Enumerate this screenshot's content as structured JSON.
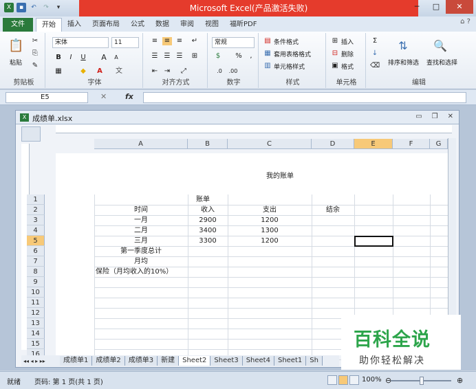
{
  "window": {
    "title": "Microsoft Excel(产品激活失败)",
    "minimize": "─",
    "maximize": "□",
    "close": "✕"
  },
  "ribbon_tabs": [
    "文件",
    "开始",
    "插入",
    "页面布局",
    "公式",
    "数据",
    "审阅",
    "视图",
    "福昕PDF"
  ],
  "ribbon": {
    "clipboard": {
      "label": "剪贴板",
      "paste": "粘贴"
    },
    "font": {
      "label": "字体",
      "name": "宋体",
      "size": "11",
      "bold": "B",
      "italic": "I",
      "underline": "U",
      "grow": "A",
      "shrink": "A"
    },
    "alignment": {
      "label": "对齐方式"
    },
    "number": {
      "label": "数字",
      "format": "常规",
      "percent": "%",
      "comma": ","
    },
    "styles": {
      "label": "样式",
      "conditional": "条件格式",
      "table": "套用表格格式",
      "cell": "单元格样式"
    },
    "cells": {
      "label": "单元格",
      "insert": "插入",
      "delete": "删除",
      "format": "格式"
    },
    "editing": {
      "label": "编辑",
      "sort": "排序和筛选",
      "find": "查找和选择"
    }
  },
  "formula_bar": {
    "name_box": "E5",
    "fx": "fx"
  },
  "workbook": {
    "filename": "成绩单.xlsx",
    "columns": [
      "A",
      "B",
      "C",
      "D",
      "E",
      "F",
      "G"
    ],
    "selected_column": "E",
    "selected_row": "5",
    "header_text": "我的账单",
    "rows": [
      {
        "num": "1",
        "A": "",
        "B": "账单",
        "C": "",
        "D": ""
      },
      {
        "num": "2",
        "A": "时间",
        "B": "收入",
        "C": "支出",
        "D": "结余"
      },
      {
        "num": "3",
        "A": "一月",
        "B": "2900",
        "C": "1200",
        "D": ""
      },
      {
        "num": "4",
        "A": "二月",
        "B": "3400",
        "C": "1300",
        "D": ""
      },
      {
        "num": "5",
        "A": "三月",
        "B": "3300",
        "C": "1200",
        "D": ""
      },
      {
        "num": "6",
        "A": "第一季度总计",
        "B": "",
        "C": "",
        "D": ""
      },
      {
        "num": "7",
        "A": "月均",
        "B": "",
        "C": "",
        "D": ""
      },
      {
        "num": "8",
        "A": "保险（月均收入的10%）",
        "B": "",
        "C": "",
        "D": ""
      },
      {
        "num": "9"
      },
      {
        "num": "10"
      },
      {
        "num": "11"
      },
      {
        "num": "12"
      },
      {
        "num": "13"
      },
      {
        "num": "14"
      },
      {
        "num": "15"
      },
      {
        "num": "16"
      }
    ],
    "sheets": [
      "成绩单1",
      "成绩单2",
      "成绩单3",
      "新建",
      "Sheet2",
      "Sheet3",
      "Sheet4",
      "Sheet1",
      "Sh"
    ],
    "active_sheet": "Sheet2"
  },
  "status": {
    "ready": "就绪",
    "page": "页码: 第 1 页(共 1 页)",
    "zoom": "100%"
  },
  "watermark": {
    "line1": "百科全说",
    "line2": "助你轻松解决"
  }
}
